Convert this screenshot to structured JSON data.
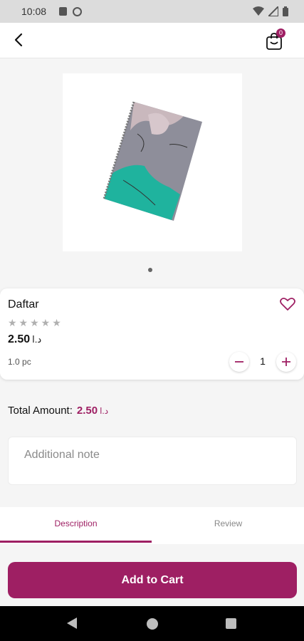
{
  "status_bar": {
    "time": "10:08"
  },
  "app_bar": {
    "cart_count": "0"
  },
  "product": {
    "name": "Daftar",
    "stars": "★★★★★",
    "price": "2.50",
    "currency": "د.ا",
    "unit": "1.0 pc",
    "quantity": "1"
  },
  "total": {
    "label": "Total Amount:",
    "value": "2.50",
    "currency": "د.ا"
  },
  "note": {
    "placeholder": "Additional note"
  },
  "tabs": [
    {
      "label": "Description"
    },
    {
      "label": "Review"
    }
  ],
  "cta": {
    "label": "Add to Cart"
  },
  "colors": {
    "accent": "#9e1f63",
    "teal": "#1fb39e",
    "notebook_gray": "#8e8e9a"
  },
  "icons": [
    "back-arrow-icon",
    "cart-icon",
    "heart-icon",
    "minus-icon",
    "plus-icon"
  ]
}
